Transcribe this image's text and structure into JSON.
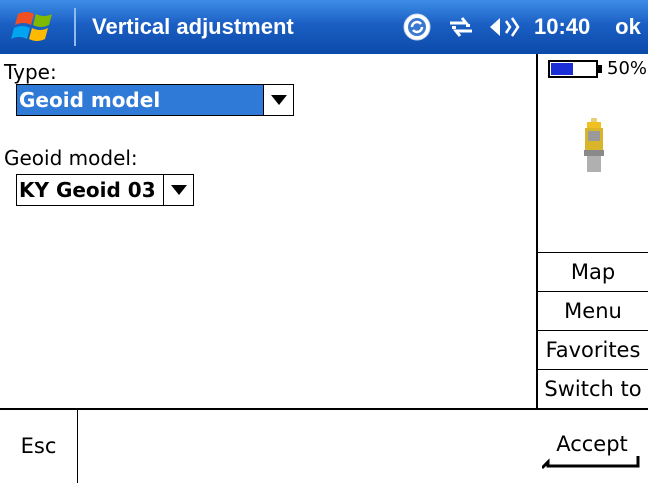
{
  "window": {
    "title": "Vertical adjustment",
    "clock": "10:40",
    "ok_label": "ok",
    "tray_icons": [
      "sync-icon",
      "connectivity-icon",
      "volume-icon"
    ]
  },
  "form": {
    "type_label": "Type:",
    "type_value": "Geoid model",
    "geoid_label": "Geoid model:",
    "geoid_value": "KY Geoid 03"
  },
  "status": {
    "battery_text": "50%",
    "battery_level": 0.5,
    "instrument_icon": "total-station-icon"
  },
  "side_buttons": [
    {
      "label": "Map"
    },
    {
      "label": "Menu"
    },
    {
      "label": "Favorites"
    },
    {
      "label": "Switch to"
    }
  ],
  "bottom": {
    "esc_label": "Esc",
    "accept_label": "Accept"
  },
  "colors": {
    "titlebar": "#1b5fc4",
    "selection": "#2f7ad6",
    "battery_fill": "#1b2fd6"
  }
}
